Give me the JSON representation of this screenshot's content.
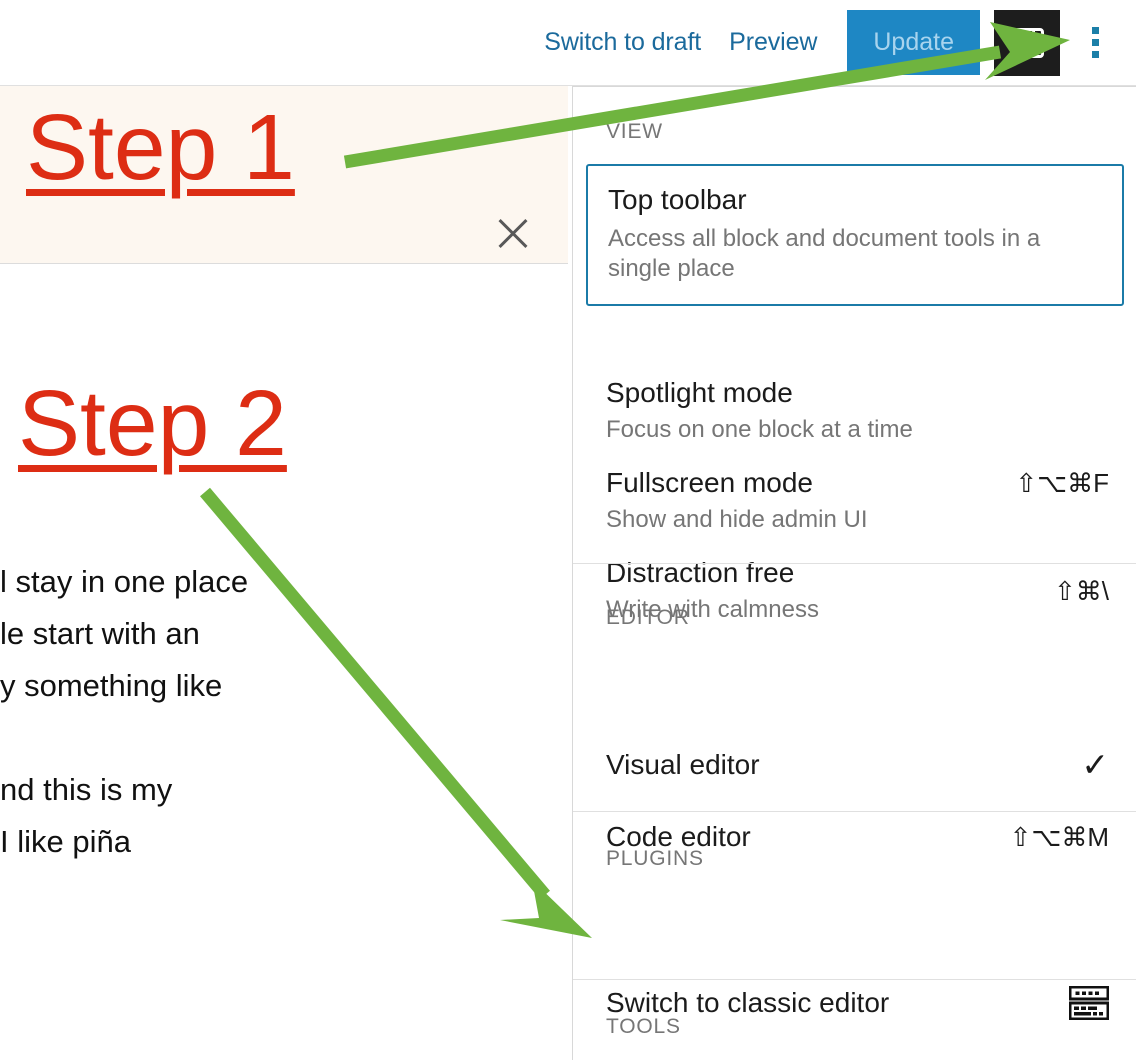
{
  "header": {
    "switch_to_draft": "Switch to draft",
    "preview": "Preview",
    "update": "Update",
    "sidebar_toggle_name": "settings-sidebar-toggle",
    "kebab_name": "options-menu-button",
    "link_color": "#1b6a9c",
    "update_bg": "#1e87c4",
    "update_text_color": "#a8d4ee",
    "kebab_color": "#1b7fa8"
  },
  "canvas": {
    "notice": {
      "title": "Step 1",
      "close_label": "Dismiss this notice",
      "bg": "#fdf7f0",
      "title_color": "#dd2d14"
    },
    "step2": {
      "title": "Step 2",
      "title_color": "#dd2d14"
    },
    "body_lines": [
      "l stay in one place",
      "le start with an",
      "y something like",
      "",
      "nd this is my",
      "I like piña"
    ]
  },
  "menu": {
    "sections": {
      "view": "VIEW",
      "editor": "EDITOR",
      "plugins": "PLUGINS",
      "tools": "TOOLS"
    },
    "items": {
      "top_toolbar": {
        "title": "Top toolbar",
        "desc": "Access all block and document tools in a single place",
        "selected": true,
        "border_color": "#1b7ba8"
      },
      "spotlight": {
        "title": "Spotlight mode",
        "desc": "Focus on one block at a time",
        "shortcut": ""
      },
      "fullscreen": {
        "title": "Fullscreen mode",
        "desc": "Show and hide admin UI",
        "shortcut": "⇧⌥⌘F"
      },
      "distraction_free": {
        "title": "Distraction free",
        "desc": "Write with calmness",
        "shortcut": "⇧⌘\\"
      },
      "visual_editor": {
        "title": "Visual editor",
        "check": "✓",
        "checked": true
      },
      "code_editor": {
        "title": "Code editor",
        "shortcut": "⇧⌥⌘M"
      },
      "switch_classic": {
        "title": "Switch to classic editor",
        "icon": "keyboard-icon"
      }
    }
  },
  "annotations": {
    "arrow_color": "#6fb43f",
    "arrow_1_name": "arrow-to-options-menu",
    "arrow_2_name": "arrow-to-switch-classic-editor"
  }
}
